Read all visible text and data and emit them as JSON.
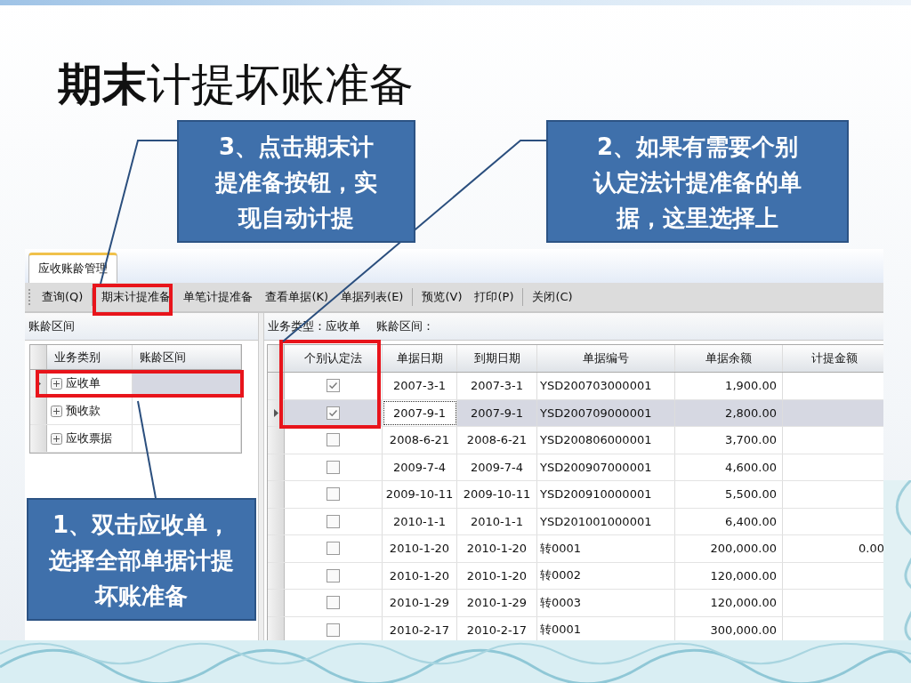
{
  "slide": {
    "title": "**期末**计提坏账准备"
  },
  "callouts": [
    {
      "kind": "top-left",
      "text": "3、点击期末计提准备按钮，实现自动计提"
    },
    {
      "kind": "top-right",
      "text": "2、如果有需要个别认定法计提准备的单据，这里选择上"
    },
    {
      "kind": "bottom-left",
      "text": "1、双击应收单，选择全部单据计提坏账准备"
    }
  ],
  "window": {
    "tabs": [
      {
        "label": "应收账龄管理",
        "selected": true
      }
    ],
    "toolbar": [
      {
        "label": "查询(Q)",
        "separator_before": false
      },
      {
        "label": "期末计提准备",
        "separator_before": true
      },
      {
        "label": "单笔计提准备",
        "separator_before": false
      },
      {
        "label": "查看单据(K)",
        "separator_before": false
      },
      {
        "label": "单据列表(E)",
        "separator_before": false
      },
      {
        "label": "预览(V)",
        "separator_before": true
      },
      {
        "label": "打印(P)",
        "separator_before": false
      },
      {
        "label": "关闭(C)",
        "separator_before": true
      }
    ],
    "left_panel": {
      "title": "账龄区间",
      "columns": [
        "业务类别",
        "账龄区间"
      ],
      "rows": [
        {
          "category": "应收单",
          "selected": true
        },
        {
          "category": "预收款",
          "selected": false
        },
        {
          "category": "应收票据",
          "selected": false
        }
      ]
    },
    "right_panel": {
      "business_type": "业务类型：应收单",
      "aging_range": "账龄区间：",
      "columns": [
        "个别认定法",
        "单据日期",
        "到期日期",
        "单据编号",
        "单据余额",
        "计提金额"
      ],
      "rows": [
        {
          "checked": true,
          "selected": false,
          "date": "2007-3-1",
          "due": "2007-3-1",
          "number": "YSD200703000001",
          "balance": "1,900.00"
        },
        {
          "checked": true,
          "selected": true,
          "date": "2007-9-1",
          "due": "2007-9-1",
          "number": "YSD200709000001",
          "balance": "2,800.00"
        },
        {
          "checked": false,
          "selected": false,
          "date": "2008-6-21",
          "due": "2008-6-21",
          "number": "YSD200806000001",
          "balance": "3,700.00"
        },
        {
          "checked": false,
          "selected": false,
          "date": "2009-7-4",
          "due": "2009-7-4",
          "number": "YSD200907000001",
          "balance": "4,600.00"
        },
        {
          "checked": false,
          "selected": false,
          "date": "2009-10-11",
          "due": "2009-10-11",
          "number": "YSD200910000001",
          "balance": "5,500.00"
        },
        {
          "checked": false,
          "selected": false,
          "date": "2010-1-1",
          "due": "2010-1-1",
          "number": "YSD201001000001",
          "balance": "6,400.00"
        },
        {
          "checked": false,
          "selected": false,
          "date": "2010-1-20",
          "due": "2010-1-20",
          "number": "转0001",
          "balance": "200,000.00",
          "provision": "0.00"
        },
        {
          "checked": false,
          "selected": false,
          "date": "2010-1-20",
          "due": "2010-1-20",
          "number": "转0002",
          "balance": "120,000.00"
        },
        {
          "checked": false,
          "selected": false,
          "date": "2010-1-29",
          "due": "2010-1-29",
          "number": "转0003",
          "balance": "120,000.00"
        },
        {
          "checked": false,
          "selected": false,
          "date": "2010-2-17",
          "due": "2010-2-17",
          "number": "转0001",
          "balance": "300,000.00"
        }
      ]
    }
  }
}
